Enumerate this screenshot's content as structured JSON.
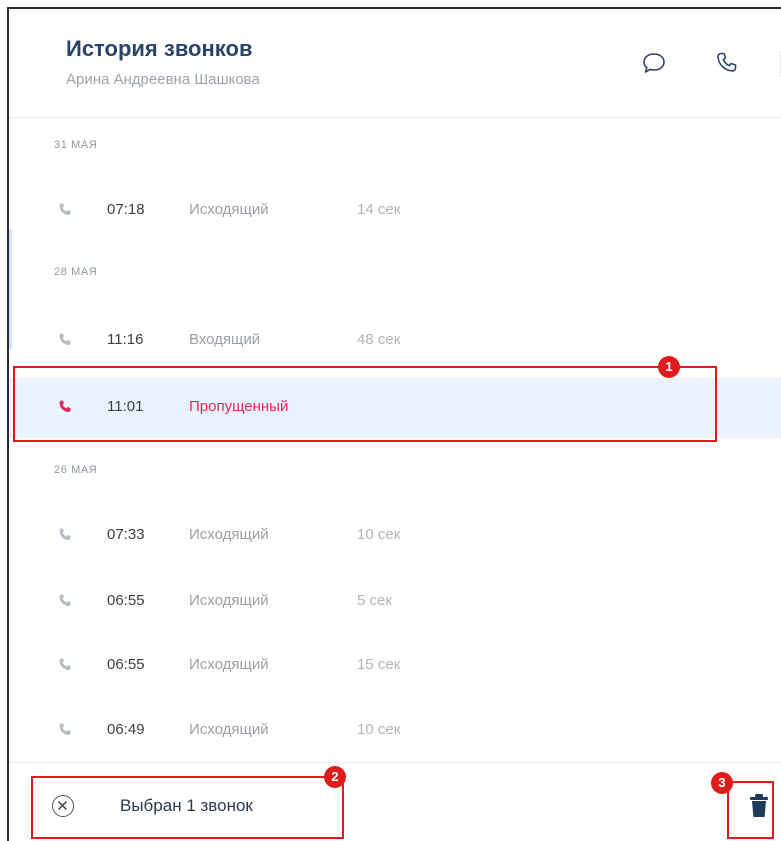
{
  "header": {
    "title": "История звонков",
    "subtitle": "Арина Андреевна Шашкова",
    "icons": [
      "chat-icon",
      "phone-icon"
    ]
  },
  "groups": [
    {
      "date": "31 МАЯ",
      "calls": [
        {
          "time": "07:18",
          "type": "Исходящий",
          "duration": "14 сек"
        }
      ]
    },
    {
      "date": "28 МАЯ",
      "calls": [
        {
          "time": "11:16",
          "type": "Входящий",
          "duration": "48 сек"
        },
        {
          "time": "11:01",
          "type": "Пропущенный",
          "duration": "",
          "selected": true
        }
      ]
    },
    {
      "date": "26 МАЯ",
      "calls": [
        {
          "time": "07:33",
          "type": "Исходящий",
          "duration": "10 сек"
        },
        {
          "time": "06:55",
          "type": "Исходящий",
          "duration": "5 сек"
        },
        {
          "time": "06:55",
          "type": "Исходящий",
          "duration": "15 сек"
        },
        {
          "time": "06:49",
          "type": "Исходящий",
          "duration": "10 сек"
        }
      ]
    }
  ],
  "footer": {
    "selection_text": "Выбран 1 звонок"
  },
  "annotations": [
    "1",
    "2",
    "3"
  ],
  "colors": {
    "accent": "#2a4468",
    "missed": "#e0285a",
    "selected_bg": "#e9f2fd",
    "annotation": "#e01b1b"
  }
}
